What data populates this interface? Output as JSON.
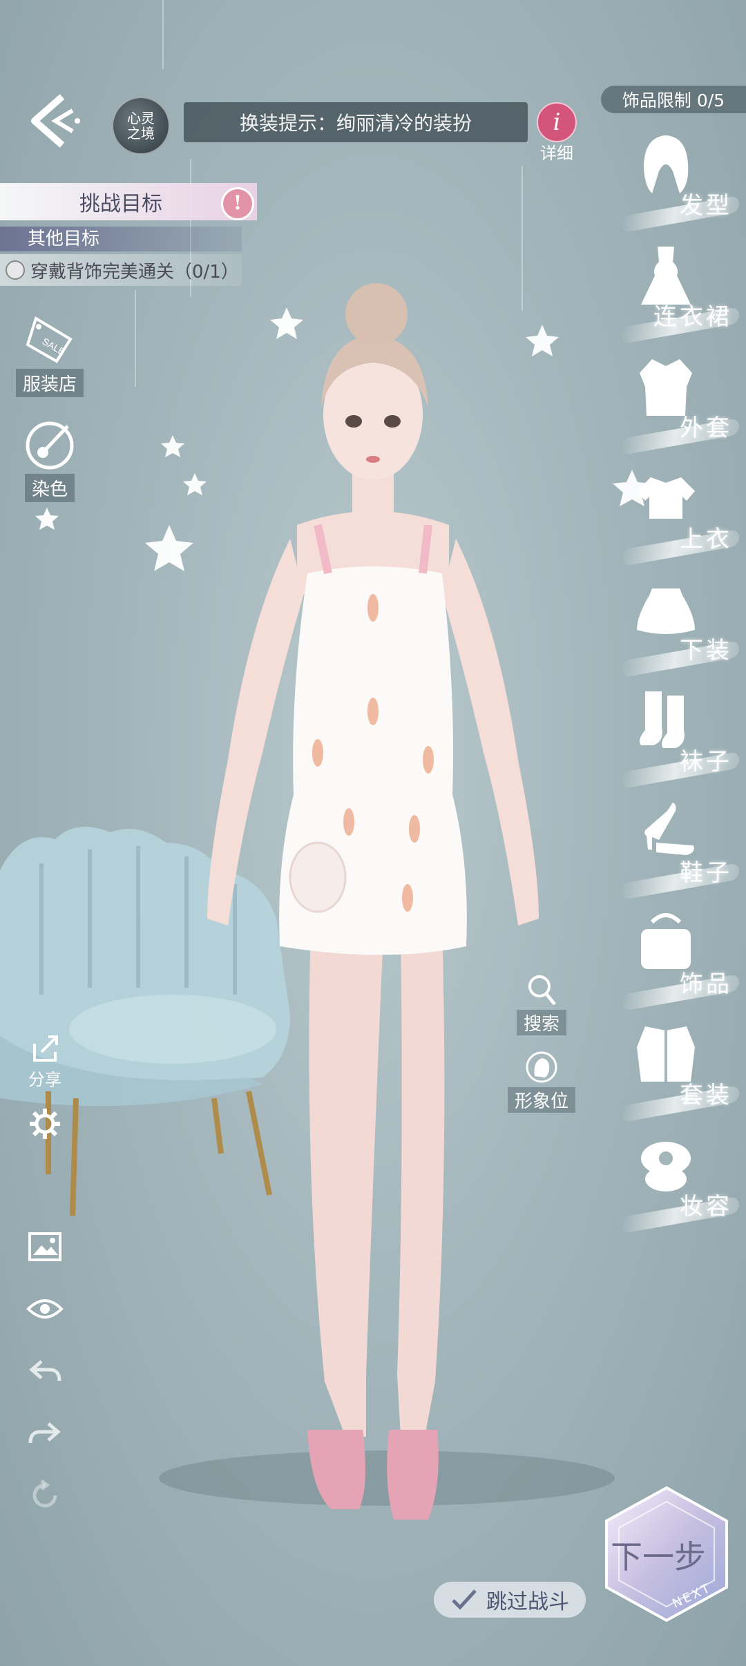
{
  "header": {
    "realm_line1": "心灵",
    "realm_line2": "之境",
    "hint": "换装提示：绚丽清冷的装扮",
    "detail_label": "详细",
    "detail_icon": "i",
    "accessory_limit": "饰品限制 0/5"
  },
  "challenge": {
    "title": "挑战目标",
    "warn": "!",
    "other_title": "其他目标",
    "goal": "穿戴背饰完美通关（0/1）"
  },
  "left_tools": {
    "shop": "服装店",
    "shop_tag": "SALE",
    "dye": "染色",
    "share": "分享"
  },
  "categories": [
    {
      "label": "发型",
      "icon": "hair-icon"
    },
    {
      "label": "连衣裙",
      "icon": "dress-icon"
    },
    {
      "label": "外套",
      "icon": "coat-icon"
    },
    {
      "label": "上衣",
      "icon": "top-icon"
    },
    {
      "label": "下装",
      "icon": "skirt-icon"
    },
    {
      "label": "袜子",
      "icon": "socks-icon"
    },
    {
      "label": "鞋子",
      "icon": "shoe-icon"
    },
    {
      "label": "饰品",
      "icon": "bag-icon"
    },
    {
      "label": "套装",
      "icon": "suit-icon"
    },
    {
      "label": "妆容",
      "icon": "makeup-icon"
    }
  ],
  "middle": {
    "search": "搜索",
    "image_slot": "形象位"
  },
  "footer": {
    "skip": "跳过战斗",
    "next": "下一步",
    "next_sub": "NEXT"
  },
  "colors": {
    "accent_pink": "#d4557c",
    "bg": "#a3b6bb"
  }
}
